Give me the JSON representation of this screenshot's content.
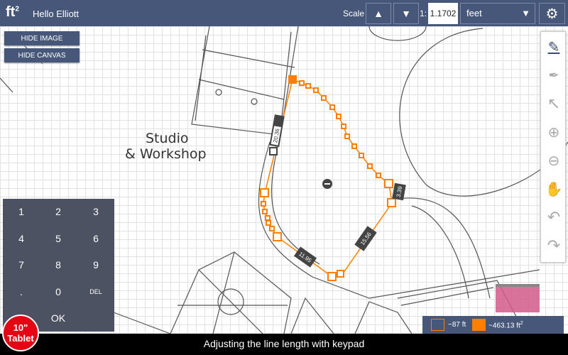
{
  "topbar": {
    "logo": "ft",
    "logo_sup": "2",
    "greeting": "Hello Elliott",
    "scale_label": "Scale",
    "scale_up": "▲",
    "scale_down": "▼",
    "ratio_prefix": "1:",
    "ratio_value": "1.1702",
    "unit": "feet",
    "unit_arrow": "▼",
    "settings_icon": "⚙"
  },
  "buttons": {
    "hide_image": "HIDE IMAGE",
    "hide_canvas": "HIDE CANVAS"
  },
  "drawing": {
    "room_label_1": "Studio",
    "room_label_2": "& Workshop",
    "segments": [
      "20.36",
      "3.39",
      "15.56",
      "11.95"
    ],
    "accent": "#ff7f00"
  },
  "keypad": {
    "keys": [
      "1",
      "2",
      "3",
      "4",
      "5",
      "6",
      "7",
      "8",
      "9",
      ".",
      "0",
      "DEL"
    ],
    "ok": "OK"
  },
  "legend": {
    "perimeter": "~87 ft",
    "area": "~463.13 ft",
    "area_sup": "2"
  },
  "tools": [
    "✎",
    "✒",
    "↖",
    "⊕",
    "⊖",
    "✋",
    "↶",
    "↷"
  ],
  "caption": "Adjusting the line length with keypad",
  "badge": {
    "line1": "10\"",
    "line2": "Tablet"
  }
}
